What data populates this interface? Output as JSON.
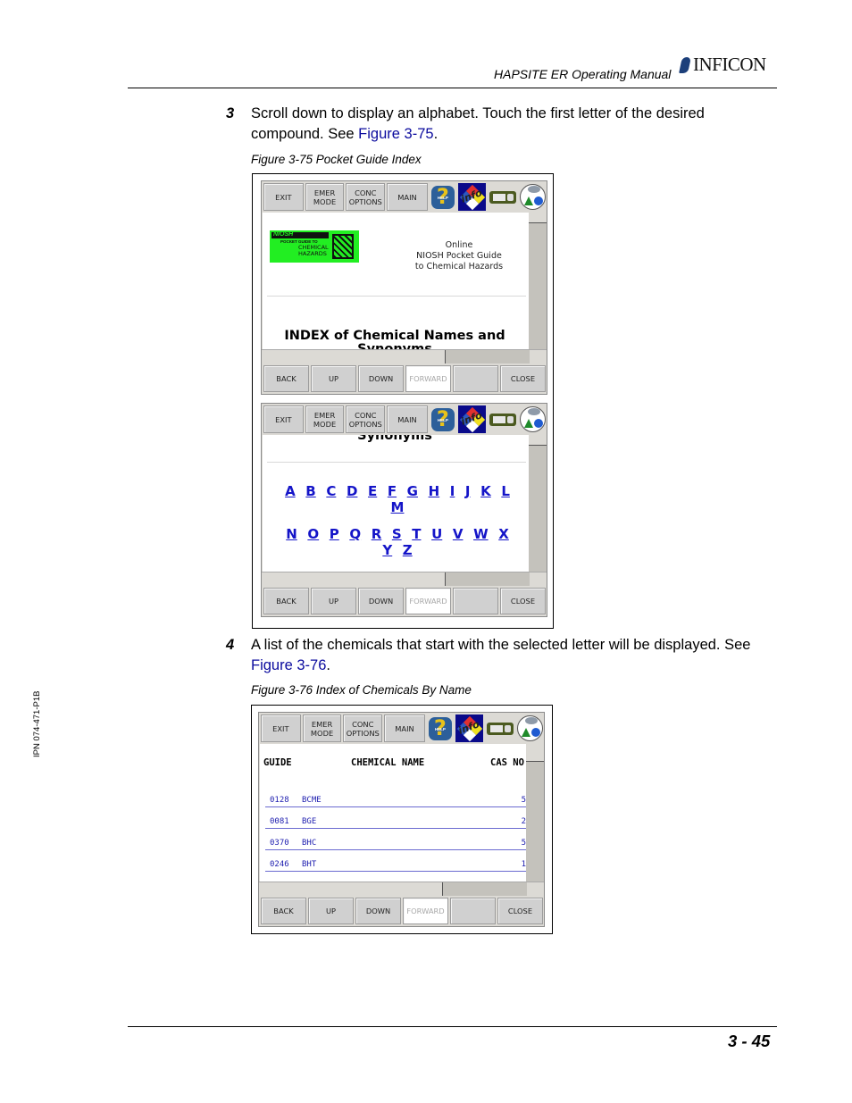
{
  "header": {
    "manual_title": "HAPSITE ER Operating Manual",
    "brand": "INFICON"
  },
  "side_label": "IPN 074-471-P1B",
  "steps": [
    {
      "number": "3",
      "text": "Scroll down to display an alphabet. Touch the first letter of the desired compound. See ",
      "link": "Figure 3-75",
      "end": "."
    },
    {
      "number": "4",
      "text": "A list of the chemicals that start with the selected letter will be displayed. See ",
      "link": "Figure 3-76",
      "end": "."
    }
  ],
  "figures": [
    {
      "caption": "Figure 3-75  Pocket Guide Index"
    },
    {
      "caption": "Figure 3-76  Index of Chemicals By Name"
    }
  ],
  "toolbar": {
    "exit": "EXIT",
    "emer_mode_1": "EMER",
    "emer_mode_2": "MODE",
    "conc_options_1": "CONC",
    "conc_options_2": "OPTIONS",
    "main": "MAIN",
    "icons": [
      "help-icon",
      "info-hazard-icon",
      "device-icon",
      "environment-icon"
    ],
    "help_label": "HELP",
    "info_label": "info"
  },
  "navbar": {
    "back": "BACK",
    "up": "UP",
    "down": "DOWN",
    "forward": "FORWARD",
    "blank": "",
    "close": "CLOSE"
  },
  "pocket_guide": {
    "logo_niosh": "NIOSH",
    "logo_sub": "POCKET GUIDE TO",
    "logo_line1": "CHEMICAL",
    "logo_line2": "HAZARDS",
    "online_1": "Online",
    "online_2": "NIOSH Pocket Guide",
    "online_3": "to Chemical Hazards",
    "index_title": "INDEX of Chemical Names and",
    "index_title_cont": "Synonyms"
  },
  "alphabet": {
    "row1": [
      "A",
      "B",
      "C",
      "D",
      "E",
      "F",
      "G",
      "H",
      "I",
      "J",
      "K",
      "L"
    ],
    "row1_wrap": [
      "M"
    ],
    "row2": [
      "N",
      "O",
      "P",
      "Q",
      "R",
      "S",
      "T",
      "U",
      "V",
      "W",
      "X"
    ],
    "row2_wrap": [
      "Y",
      "Z"
    ]
  },
  "chemical_index": {
    "columns": {
      "guide": "GUIDE",
      "name": "CHEMICAL NAME",
      "cas": "CAS NO"
    },
    "rows": [
      {
        "guide": "0128",
        "name": "BCME",
        "cas": "5"
      },
      {
        "guide": "0081",
        "name": "BGE",
        "cas": "2"
      },
      {
        "guide": "0370",
        "name": "BHC",
        "cas": "5"
      },
      {
        "guide": "0246",
        "name": "BHT",
        "cas": "1"
      }
    ]
  },
  "footer": {
    "page_number": "3 - 45"
  }
}
